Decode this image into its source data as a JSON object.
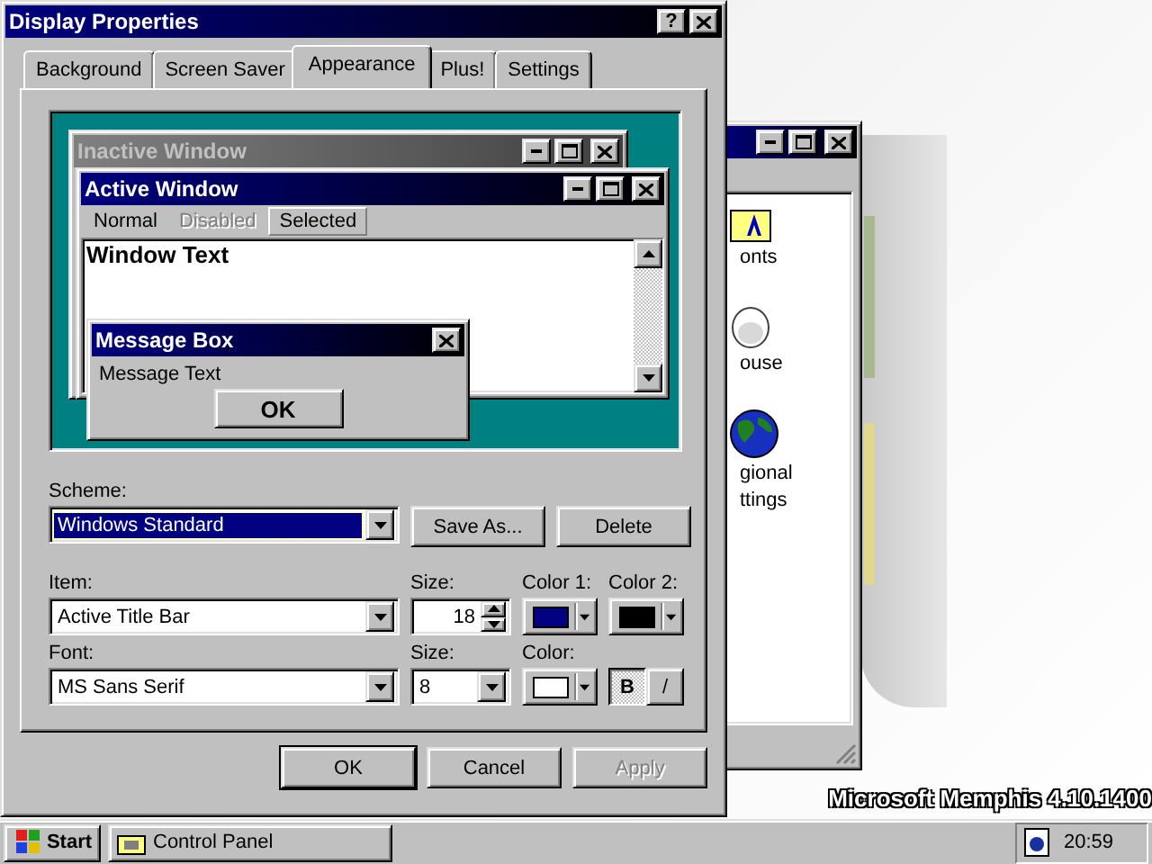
{
  "desktop": {
    "build_text": "Microsoft Memphis 4.10.1400"
  },
  "background_window": {
    "items": [
      {
        "kind": "fonts",
        "label_lines": [
          "onts"
        ]
      },
      {
        "kind": "mouse",
        "label_lines": [
          "ouse"
        ]
      },
      {
        "kind": "globe",
        "label_lines": [
          "gional",
          "ttings"
        ]
      }
    ]
  },
  "dialog": {
    "title": "Display Properties",
    "help": "?",
    "tabs": [
      {
        "label": "Background",
        "selected": false
      },
      {
        "label": "Screen Saver",
        "selected": false
      },
      {
        "label": "Appearance",
        "selected": true
      },
      {
        "label": "Plus!",
        "selected": false
      },
      {
        "label": "Settings",
        "selected": false
      }
    ],
    "preview": {
      "inactive_title": "Inactive Window",
      "active_title": "Active Window",
      "menu": [
        {
          "label": "Normal",
          "disabled": false,
          "selected": false
        },
        {
          "label": "Disabled",
          "disabled": true,
          "selected": false
        },
        {
          "label": "Selected",
          "disabled": false,
          "selected": true
        }
      ],
      "window_text": "Window Text",
      "message_title": "Message Box",
      "message_text": "Message Text",
      "message_button": "OK"
    },
    "scheme": {
      "label": "Scheme:",
      "value": "Windows Standard",
      "buttons": [
        {
          "label": "Save As...",
          "disabled": false
        },
        {
          "label": "Delete",
          "disabled": false
        }
      ]
    },
    "item_row": {
      "item": {
        "label": "Item:",
        "value": "Active Title Bar"
      },
      "size": {
        "label": "Size:",
        "value": "18"
      },
      "color1": {
        "label": "Color 1:",
        "color": "#000080"
      },
      "color2": {
        "label": "Color 2:",
        "color": "#000000"
      }
    },
    "font_row": {
      "font": {
        "label": "Font:",
        "value": "MS Sans Serif"
      },
      "size": {
        "label": "Size:",
        "value": "8"
      },
      "color": {
        "label": "Color:",
        "color": "#ffffff"
      },
      "bold": {
        "label": "B",
        "pressed": true
      },
      "italic": {
        "label": "/",
        "pressed": false
      }
    },
    "buttons": [
      {
        "label": "OK",
        "disabled": false
      },
      {
        "label": "Cancel",
        "disabled": false
      },
      {
        "label": "Apply",
        "disabled": true
      }
    ]
  },
  "taskbar": {
    "start": "Start",
    "tasks": [
      {
        "label": "Control Panel",
        "selected": false
      }
    ],
    "clock": "20:59"
  }
}
